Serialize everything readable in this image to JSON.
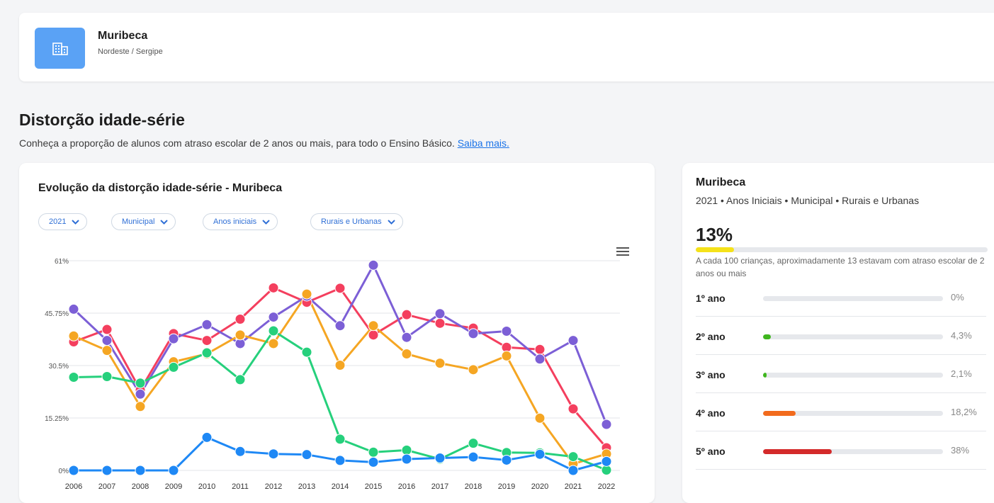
{
  "header": {
    "city": "Muribeca",
    "region": "Nordeste / Sergipe"
  },
  "section": {
    "title": "Distorção idade-série",
    "description": "Conheça a proporção de alunos com atraso escolar de 2 anos ou mais, para todo o Ensino Básico.",
    "link": "Saiba mais."
  },
  "filters": [
    {
      "label": "2021"
    },
    {
      "label": "Municipal"
    },
    {
      "label": "Anos iniciais"
    },
    {
      "label": "Rurais e Urbanas"
    }
  ],
  "chart_data": {
    "type": "line",
    "title": "Evolução da distorção idade-série - Muribeca",
    "ylabel": "",
    "xlabel": "",
    "categories": [
      "2006",
      "2007",
      "2008",
      "2009",
      "2010",
      "2011",
      "2012",
      "2013",
      "2014",
      "2015",
      "2016",
      "2017",
      "2018",
      "2019",
      "2020",
      "2021",
      "2022"
    ],
    "yticks": [
      "0%",
      "15.25%",
      "30.5%",
      "45.75%",
      "61%"
    ],
    "ylim": [
      0,
      61
    ],
    "grid": true,
    "series": [
      {
        "color": "#f43f5e",
        "values": [
          37.4,
          41,
          23.4,
          39.8,
          37.8,
          44,
          53.1,
          48.9,
          53,
          39.4,
          45.3,
          42.8,
          41.4,
          35.8,
          35.2,
          17.9,
          6.6
        ]
      },
      {
        "color": "#7c5fd6",
        "values": [
          46.9,
          37.8,
          22.2,
          38.3,
          42.4,
          36.9,
          44.6,
          50.7,
          42.1,
          59.7,
          38.7,
          45.6,
          39.8,
          40.5,
          32.4,
          37.8,
          13.4
        ]
      },
      {
        "color": "#f5a623",
        "values": [
          39.1,
          34.9,
          18.6,
          31.6,
          33.9,
          39.4,
          36.9,
          51.3,
          30.6,
          42.1,
          33.9,
          31.2,
          29.3,
          33.3,
          15.2,
          1.9,
          4.8
        ]
      },
      {
        "color": "#26d07c",
        "values": [
          27.1,
          27.3,
          25.4,
          30,
          34.2,
          26.4,
          40.6,
          34.4,
          9.1,
          5.3,
          5.9,
          3.3,
          7.9,
          5.2,
          5.1,
          4,
          0.1
        ]
      },
      {
        "color": "#1e88f5",
        "values": [
          0,
          0,
          0,
          0,
          9.6,
          5.5,
          4.8,
          4.6,
          2.9,
          2.4,
          3.3,
          3.6,
          3.9,
          3,
          4.7,
          0,
          2.6
        ]
      }
    ]
  },
  "side": {
    "title": "Muribeca",
    "subtitle": "2021 • Anos Iniciais • Municipal • Rurais e Urbanas",
    "percent_label": "13%",
    "percent_value": 13,
    "note": "A cada 100 crianças, aproximadamente 13 estavam com atraso escolar de 2 anos ou mais",
    "bar_color": "#f5e21a",
    "grades": [
      {
        "label": "1º ano",
        "value_label": "0%",
        "value": 0,
        "color": "#22b022"
      },
      {
        "label": "2º ano",
        "value_label": "4,3%",
        "value": 4.3,
        "color": "#3fb61e"
      },
      {
        "label": "3º ano",
        "value_label": "2,1%",
        "value": 2.1,
        "color": "#3fb61e"
      },
      {
        "label": "4º ano",
        "value_label": "18,2%",
        "value": 18.2,
        "color": "#f26b1d"
      },
      {
        "label": "5º ano",
        "value_label": "38%",
        "value": 38,
        "color": "#d42a2a"
      }
    ]
  }
}
